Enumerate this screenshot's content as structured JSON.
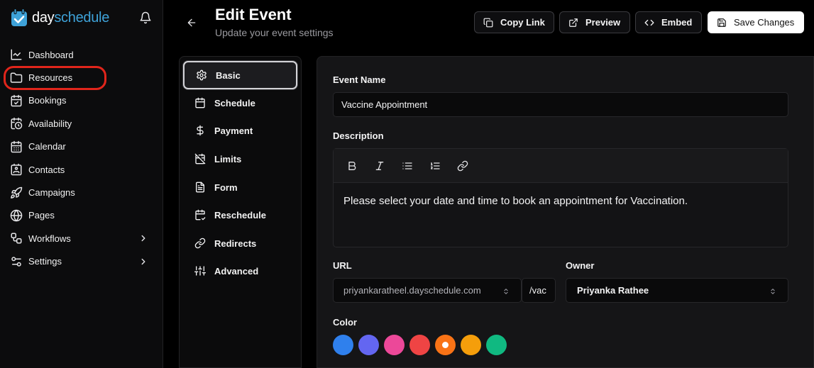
{
  "brand": {
    "part1": "day",
    "part2": "schedule",
    "accent": "#3ea2d8"
  },
  "sidebar": {
    "items": [
      {
        "label": "Dashboard",
        "icon": "chart-line-icon"
      },
      {
        "label": "Resources",
        "icon": "folder-icon"
      },
      {
        "label": "Bookings",
        "icon": "calendar-check-icon"
      },
      {
        "label": "Availability",
        "icon": "calendar-clock-icon"
      },
      {
        "label": "Calendar",
        "icon": "calendar-icon"
      },
      {
        "label": "Contacts",
        "icon": "contact-icon"
      },
      {
        "label": "Campaigns",
        "icon": "rocket-icon"
      },
      {
        "label": "Pages",
        "icon": "globe-icon"
      },
      {
        "label": "Workflows",
        "icon": "workflow-icon"
      },
      {
        "label": "Settings",
        "icon": "sliders-icon"
      }
    ]
  },
  "header": {
    "title": "Edit Event",
    "subtitle": "Update your event settings",
    "buttons": {
      "copy_link": "Copy Link",
      "preview": "Preview",
      "embed": "Embed",
      "save": "Save Changes"
    }
  },
  "tabs": [
    {
      "label": "Basic",
      "icon": "gear-icon",
      "active": true
    },
    {
      "label": "Schedule",
      "icon": "calendar-icon"
    },
    {
      "label": "Payment",
      "icon": "dollar-icon"
    },
    {
      "label": "Limits",
      "icon": "calendar-off-icon"
    },
    {
      "label": "Form",
      "icon": "document-icon"
    },
    {
      "label": "Reschedule",
      "icon": "calendar-repeat-icon"
    },
    {
      "label": "Redirects",
      "icon": "link-icon"
    },
    {
      "label": "Advanced",
      "icon": "sliders-vertical-icon"
    }
  ],
  "form": {
    "event_name_label": "Event Name",
    "event_name_value": "Vaccine Appointment",
    "description_label": "Description",
    "description_value": "Please select your date and time to book an appointment for Vaccination.",
    "url_label": "URL",
    "url_domain": "priyankaratheel.dayschedule.com",
    "url_slug": "/vac",
    "owner_label": "Owner",
    "owner_value": "Priyanka Rathee",
    "color_label": "Color",
    "colors": [
      "#2f80ed",
      "#6366f1",
      "#ec4899",
      "#ef4444",
      "#f97316",
      "#f59e0b",
      "#10b981"
    ],
    "selected_color": "#f97316"
  }
}
